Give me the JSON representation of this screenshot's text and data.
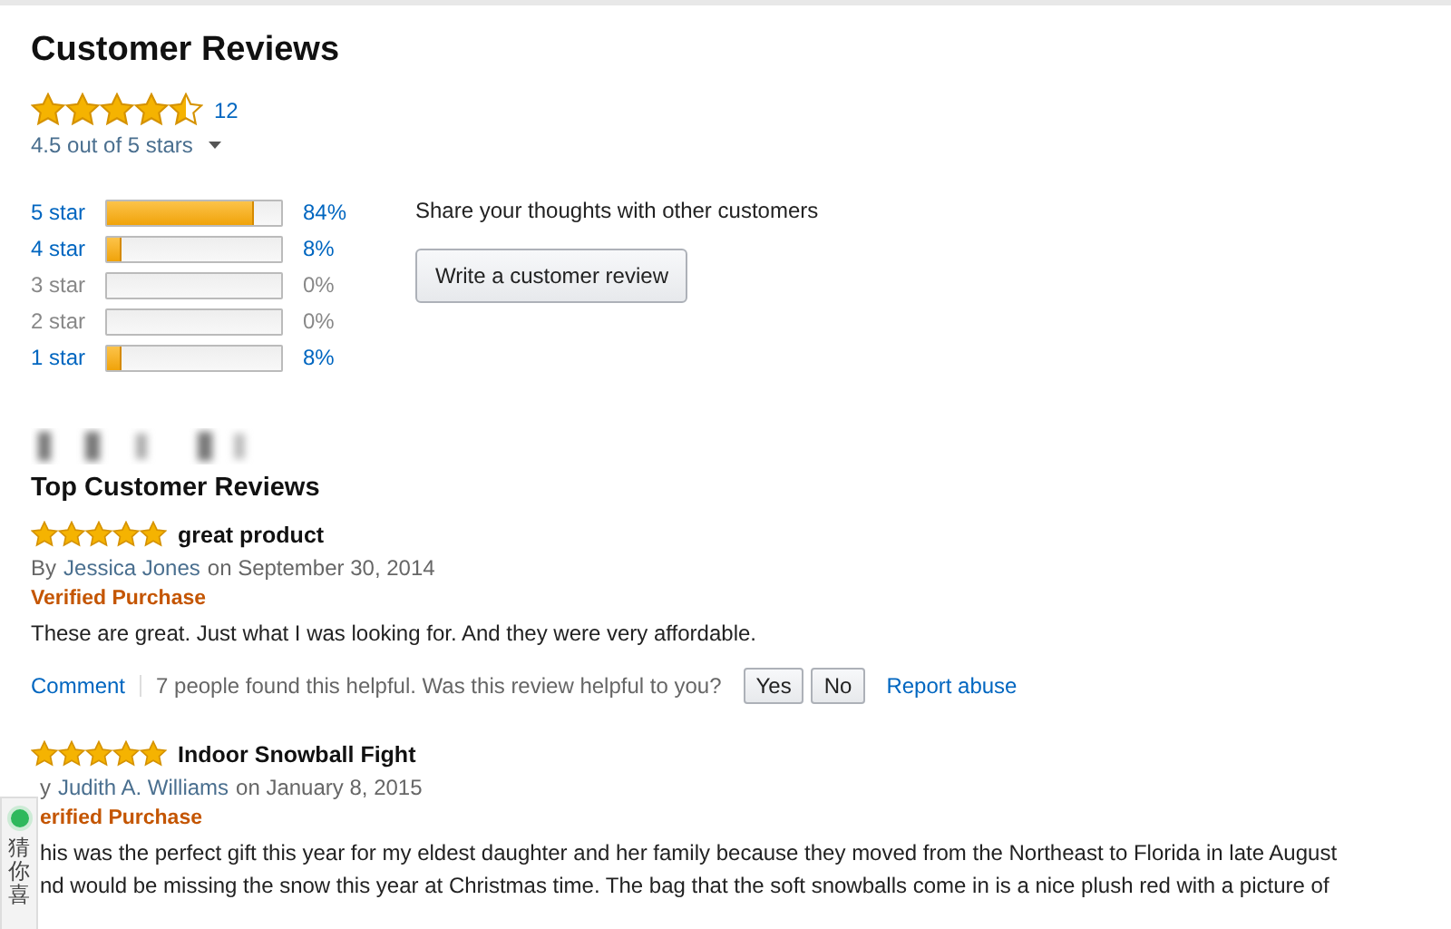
{
  "title": "Customer Reviews",
  "summary": {
    "stars": 4.5,
    "count": "12",
    "rating_text": "4.5 out of 5 stars"
  },
  "histogram": [
    {
      "label": "5 star",
      "level": 0.84,
      "percent": "84%",
      "disabled": false
    },
    {
      "label": "4 star",
      "level": 0.08,
      "percent": "8%",
      "disabled": false
    },
    {
      "label": "3 star",
      "percent": "0%",
      "disabled": true
    },
    {
      "label": "2 star",
      "percent": "0%",
      "disabled": true
    },
    {
      "label": "1 star",
      "level": 0.08,
      "percent": "8%",
      "disabled": false
    }
  ],
  "share": {
    "prompt": "Share your thoughts with other customers",
    "button": "Write a customer review"
  },
  "top_reviews_title": "Top Customer Reviews",
  "reviews": [
    {
      "stars": 5,
      "title": "great product",
      "by": "By",
      "author": "Jessica Jones",
      "date": "on September 30, 2014",
      "verified": "Verified Purchase",
      "body": "These are great. Just what I was looking for. And they were very affordable.",
      "actions": {
        "comment": "Comment",
        "helpful": "7 people found this helpful. Was this review helpful to you?",
        "yes": "Yes",
        "no": "No",
        "report": "Report abuse"
      }
    },
    {
      "stars": 5,
      "title": "Indoor Snowball Fight",
      "by": "y",
      "author": "Judith A. Williams",
      "date": "on January 8, 2015",
      "verified": "erified Purchase",
      "body": "his was the perfect gift this year for my eldest daughter and her family because they moved from the Northeast to Florida in late August\nnd would be missing the snow this year at Christmas time. The bag that the soft snowballs come in is a nice plush red with a picture of"
    }
  ],
  "side_widget": {
    "label": "猜你喜"
  }
}
